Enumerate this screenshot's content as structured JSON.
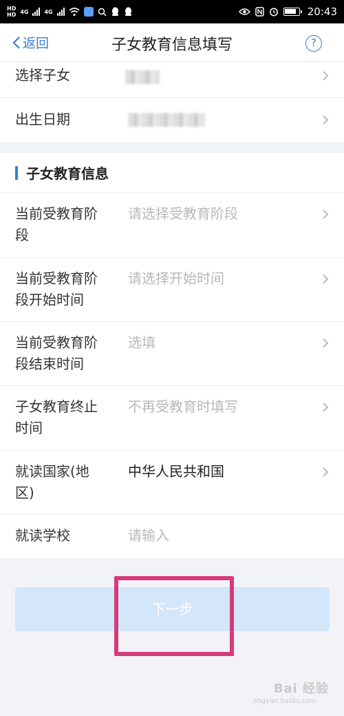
{
  "status_bar": {
    "net_labels": [
      "HD",
      "HD"
    ],
    "gen_labels": [
      "4G",
      "4G"
    ],
    "time": "20:43"
  },
  "nav": {
    "back_label": "返回",
    "title": "子女教育信息填写",
    "help_symbol": "?"
  },
  "child_info": {
    "rows": [
      {
        "label": "选择子女"
      },
      {
        "label": "出生日期"
      }
    ]
  },
  "education": {
    "section_title": "子女教育信息",
    "rows": [
      {
        "label_line1": "当前受教育阶",
        "label_line2": "段",
        "value": "请选择受教育阶段",
        "value_is_placeholder": true
      },
      {
        "label_line1": "当前受教育阶",
        "label_line2": "段开始时间",
        "value": "请选择开始时间",
        "value_is_placeholder": true
      },
      {
        "label_line1": "当前受教育阶",
        "label_line2": "段结束时间",
        "value": "选填",
        "value_is_placeholder": true
      },
      {
        "label_line1": "子女教育终止",
        "label_line2": "时间",
        "value": "不再受教育时填写",
        "value_is_placeholder": true
      },
      {
        "label_line1": "就读国家(地",
        "label_line2": "区)",
        "value": "中华人民共和国",
        "value_is_placeholder": false
      },
      {
        "label_line1": "就读学校",
        "label_line2": "",
        "value": "请输入",
        "value_is_placeholder": true
      }
    ]
  },
  "next_button": {
    "label": "下一步"
  },
  "watermark": {
    "text": "Bai 经验",
    "url": "jingyan.baidu.com"
  },
  "colors": {
    "accent": "#3a7bd5",
    "button_bg": "#d4e6fa",
    "highlight": "#d63a7c",
    "page_bg": "#f2f3f7"
  }
}
